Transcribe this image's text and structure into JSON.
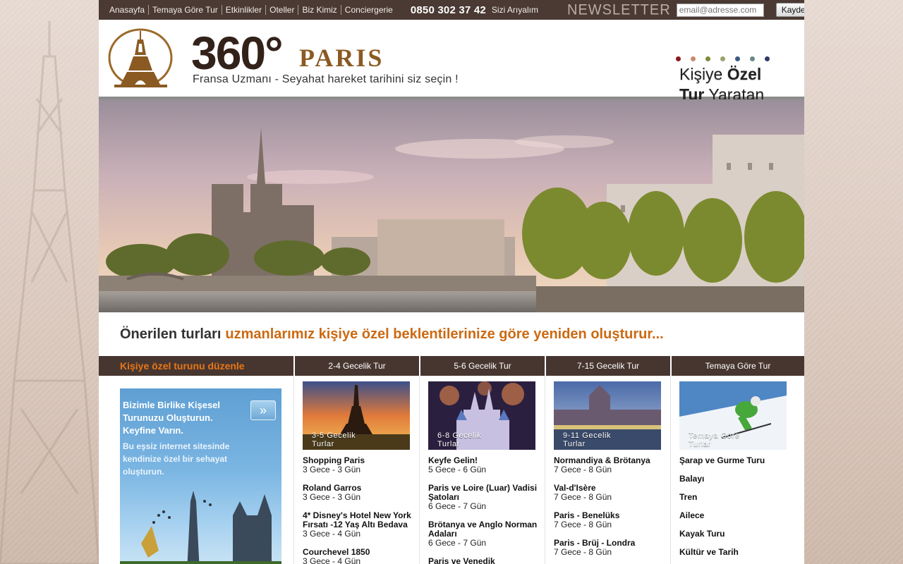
{
  "topbar": {
    "nav": [
      "Anasayfa",
      "Temaya Göre Tur",
      "Etkinlikler",
      "Oteller",
      "Biz Kimiz",
      "Conciergerie"
    ],
    "phone": "0850 302 37 42",
    "callback": "Sizi Arıyalım",
    "newsletter_label": "Newsletter",
    "email_placeholder": "email@adresse.com",
    "save_label": "Kaydet"
  },
  "header": {
    "brand_number": "360°",
    "brand_city": "PARIS",
    "tagline": "Fransa Uzmanı - Seyahat hareket tarihini siz seçin !",
    "slogan_word1": "Kişiye",
    "slogan_word2": "Özel",
    "slogan_word3": "Tur",
    "slogan_word4": "Yaratan",
    "dot_colors": [
      "#8b1a1a",
      "#c98a6e",
      "#7d8a3a",
      "#9aa36a",
      "#3d5a80",
      "#6a8a8a",
      "#2e3a66"
    ]
  },
  "headline": {
    "part1": "Önerilen turları",
    "part2": "uzmanlarımız kişiye özel beklentilerinize göre yeniden oluşturur..."
  },
  "tabs": {
    "first": "Kişiye özel turunu düzenle",
    "items": [
      "2-4 Gecelik Tur",
      "5-6 Gecelik Tur",
      "7-15 Gecelik Tur",
      "Temaya Göre Tur"
    ]
  },
  "promo": {
    "title": "Bizimle Birlike Kişesel Turunuzu Oluşturun. Keyfine Varın.",
    "sub": "Bu eşsiz internet sitesinde kendinize özel bir sehayat oluşturun.",
    "go": "»"
  },
  "columns": [
    {
      "thumb_label1": "3-5 Gecelik",
      "thumb_label2": "Turlar",
      "tours": [
        {
          "name": "Shopping Paris",
          "dur": "3 Gece - 3 Gün"
        },
        {
          "name": "Roland Garros",
          "dur": "3 Gece - 3 Gün"
        },
        {
          "name": "4* Disney's Hotel New York Fırsatı -12 Yaş Altı Bedava",
          "dur": "3 Gece - 4 Gün"
        },
        {
          "name": "Courchevel 1850",
          "dur": "3 Gece - 4 Gün"
        }
      ]
    },
    {
      "thumb_label1": "6-8 Gecelik",
      "thumb_label2": "Turlar",
      "tours": [
        {
          "name": "Keyfe Gelin!",
          "dur": "5 Gece - 6 Gün"
        },
        {
          "name": "Paris ve Loire (Luar) Vadisi Şatoları",
          "dur": "6 Gece - 7 Gün"
        },
        {
          "name": "Brötanya ve Anglo Norman Adaları",
          "dur": "6 Gece - 7 Gün"
        },
        {
          "name": "Paris ve Venedik",
          "dur": ""
        }
      ]
    },
    {
      "thumb_label1": "9-11 Gecelik",
      "thumb_label2": "Turlar",
      "tours": [
        {
          "name": "Normandiya & Brötanya",
          "dur": "7 Gece - 8 Gün"
        },
        {
          "name": "Val-d'Isère",
          "dur": "7 Gece - 8 Gün"
        },
        {
          "name": "Paris - Benelüks",
          "dur": "7 Gece - 8 Gün"
        },
        {
          "name": "Paris - Brüj - Londra",
          "dur": "7 Gece - 8 Gün"
        }
      ]
    }
  ],
  "themes": {
    "thumb_label1": "Temaya Göre",
    "thumb_label2": "Turlar",
    "items": [
      "Şarap ve Gurme Turu",
      "Balayı",
      "Tren",
      "Ailece",
      "Kayak Turu",
      "Kültür ve Tarih"
    ]
  }
}
